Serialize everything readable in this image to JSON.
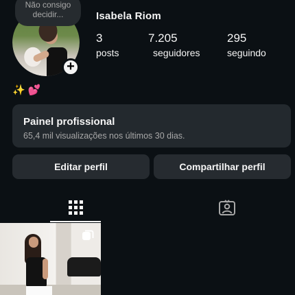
{
  "note": {
    "line1": "Não consigo",
    "line2": "decidir..."
  },
  "profile": {
    "username": "Isabela Riom",
    "stats": {
      "posts": {
        "value": "3",
        "label": "posts"
      },
      "followers": {
        "value": "7.205",
        "label": "seguidores"
      },
      "following": {
        "value": "295",
        "label": "seguindo"
      }
    },
    "bio": {
      "sparkle": "✨",
      "hearts": "💕"
    }
  },
  "professional_panel": {
    "title": "Painel profissional",
    "subtitle": "65,4 mil visualizações nos últimos 30 dias."
  },
  "buttons": {
    "edit": "Editar perfil",
    "share": "Compartilhar perfil"
  },
  "tabs": [
    {
      "icon": "grid-icon",
      "active": true
    },
    {
      "icon": "tagged-person-icon",
      "active": false
    }
  ],
  "icons": {
    "add_story": "+",
    "multi_post": "carousel-icon"
  },
  "colors": {
    "background": "#0b1014",
    "panel": "#23292e",
    "button": "#262b30",
    "secondary_text": "#a8a8a8"
  }
}
